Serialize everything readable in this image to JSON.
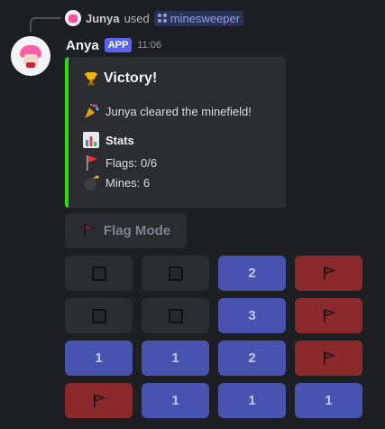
{
  "reply": {
    "user": "Junya",
    "used_text": "used",
    "command": "minesweeper"
  },
  "message": {
    "author": "Anya",
    "badge": "APP",
    "time": "11:06"
  },
  "embed": {
    "accent_color": "#22e212",
    "title": "Victory!",
    "description": "Junya cleared the minefield!",
    "stats_title": "Stats",
    "flags": "Flags: 0/6",
    "mines": "Mines: 6"
  },
  "flag_mode_label": "Flag Mode",
  "board": [
    [
      {
        "type": "hidden"
      },
      {
        "type": "hidden"
      },
      {
        "type": "number",
        "label": "2"
      },
      {
        "type": "flag"
      }
    ],
    [
      {
        "type": "hidden"
      },
      {
        "type": "hidden"
      },
      {
        "type": "number",
        "label": "3"
      },
      {
        "type": "flag"
      }
    ],
    [
      {
        "type": "number",
        "label": "1"
      },
      {
        "type": "number",
        "label": "1"
      },
      {
        "type": "number",
        "label": "2"
      },
      {
        "type": "flag"
      }
    ],
    [
      {
        "type": "flag"
      },
      {
        "type": "number",
        "label": "1"
      },
      {
        "type": "number",
        "label": "1"
      },
      {
        "type": "number",
        "label": "1"
      }
    ]
  ],
  "colors": {
    "number_cell": "#4853b0",
    "flag_cell": "#8b2a2d",
    "hidden_cell": "#2b2d31",
    "app_badge": "#5865f2"
  }
}
